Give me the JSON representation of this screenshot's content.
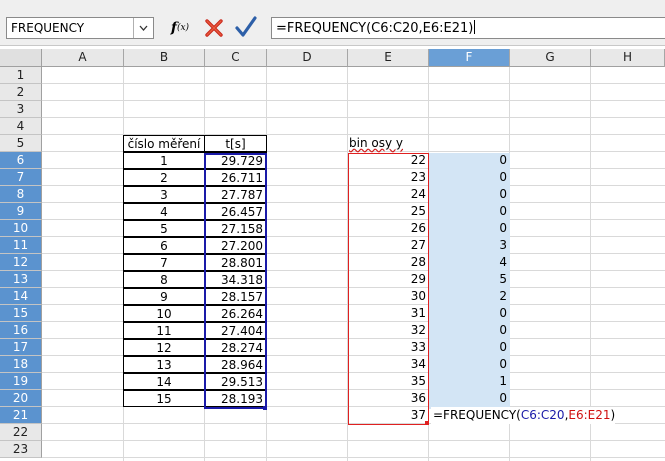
{
  "name_box": {
    "value": "FREQUENCY"
  },
  "formula_bar": {
    "function_wizard_icon": "function-wizard-icon",
    "cancel_icon": "red-x-cancel-icon",
    "accept_icon": "checkmark-accept-icon",
    "value": "=FREQUENCY(C6:C20,E6:E21)"
  },
  "columns": [
    "A",
    "B",
    "C",
    "D",
    "E",
    "F",
    "G",
    "H"
  ],
  "rows": [
    "1",
    "2",
    "3",
    "4",
    "5",
    "6",
    "7",
    "8",
    "9",
    "10",
    "11",
    "12",
    "13",
    "14",
    "15",
    "16",
    "17",
    "18",
    "19",
    "20",
    "21",
    "22",
    "23"
  ],
  "selected_column": "F",
  "selected_rows": "6-20",
  "table": {
    "header_b": "číslo měření",
    "header_c": "t[s]",
    "measurement_numbers": [
      "1",
      "2",
      "3",
      "4",
      "5",
      "6",
      "7",
      "8",
      "9",
      "10",
      "11",
      "12",
      "13",
      "14",
      "15"
    ],
    "times": [
      "29.729",
      "26.711",
      "27.787",
      "26.457",
      "27.158",
      "27.200",
      "28.801",
      "34.318",
      "28.157",
      "26.264",
      "27.404",
      "28.274",
      "28.964",
      "29.513",
      "28.193"
    ]
  },
  "bins": {
    "header": "bin osy  y",
    "values": [
      "22",
      "23",
      "24",
      "25",
      "26",
      "27",
      "28",
      "29",
      "30",
      "31",
      "32",
      "33",
      "34",
      "35",
      "36",
      "37"
    ]
  },
  "frequency_results": [
    "0",
    "0",
    "0",
    "0",
    "0",
    "3",
    "4",
    "5",
    "2",
    "0",
    "0",
    "0",
    "0",
    "1",
    "0"
  ],
  "edit_cell": {
    "prefix": "=FREQUENCY(",
    "ref1": "C6:C20",
    "sep": ",",
    "ref2": "E6:E21",
    "suffix": ")"
  },
  "colors": {
    "selection_header": "#5b93cf",
    "selection_fill": "#d3e5f5",
    "ref_blue": "#1a1aa8",
    "ref_red": "#d01010"
  }
}
